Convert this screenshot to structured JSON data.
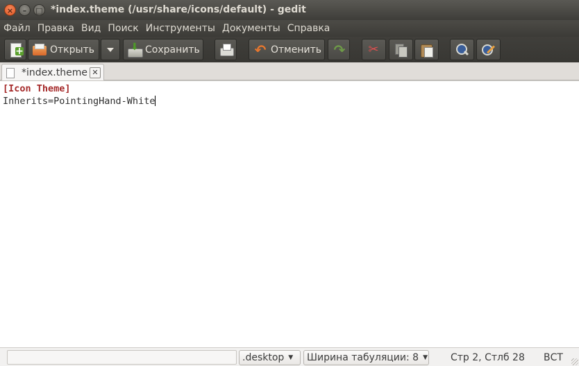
{
  "window": {
    "title": "*index.theme (/usr/share/icons/default) - gedit",
    "close_glyph": "×",
    "min_glyph": "–",
    "max_glyph": "□"
  },
  "menubar": {
    "items": [
      {
        "label": "Файл"
      },
      {
        "label": "Правка"
      },
      {
        "label": "Вид"
      },
      {
        "label": "Поиск"
      },
      {
        "label": "Инструменты"
      },
      {
        "label": "Документы"
      },
      {
        "label": "Справка"
      }
    ]
  },
  "toolbar": {
    "new_icon": "new-document-icon",
    "open_label": "Открыть",
    "save_label": "Сохранить",
    "undo_label": "Отменить",
    "undo_glyph": "↶",
    "redo_glyph": "↷",
    "cut_glyph": "✂"
  },
  "tabs": [
    {
      "label": "*index.theme",
      "close_glyph": "✕"
    }
  ],
  "editor": {
    "lines": [
      "[Icon Theme]",
      "Inherits=PointingHand-White"
    ],
    "section_color": "#a52a2a"
  },
  "statusbar": {
    "language": ".desktop",
    "tab_width": "Ширина табуляции: 8",
    "arrow_glyph": "▼",
    "position": "Стр 2, Стлб 28",
    "insert_mode": "ВСТ"
  }
}
